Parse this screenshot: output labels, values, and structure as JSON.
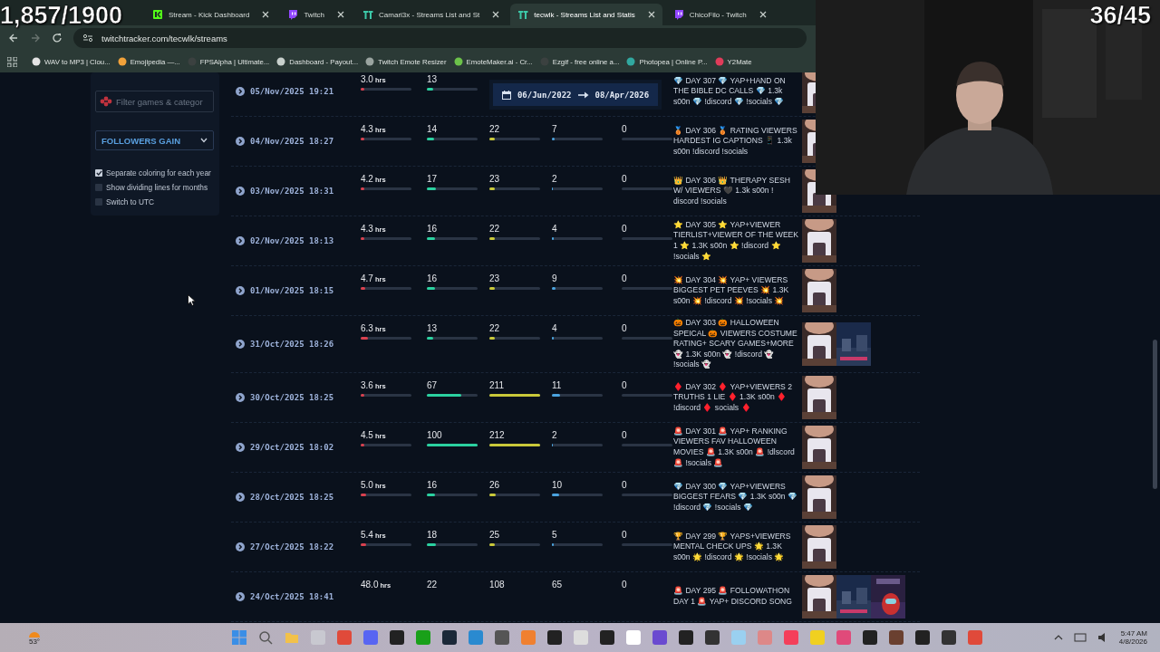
{
  "overlay": {
    "left_counter": "1,857/1900",
    "right_counter": "36/45"
  },
  "browser": {
    "tabs": [
      {
        "kind": "kick",
        "title": "Stream - Kick Dashboard",
        "selected": false
      },
      {
        "kind": "twitch",
        "title": "Twitch",
        "selected": false
      },
      {
        "kind": "tracker",
        "title": "Camari3x - Streams List and St",
        "selected": false
      },
      {
        "kind": "tracker",
        "title": "tecwlk - Streams List and Statis",
        "selected": true
      },
      {
        "kind": "twitch",
        "title": "ChicoFilo - Twitch",
        "selected": false
      }
    ],
    "address": "twitchtracker.com/tecwlk/streams",
    "bookmarks": [
      {
        "kind": "cloud",
        "title": "WAV to MP3 | Clou..."
      },
      {
        "kind": "emoji",
        "title": "Emojipedia —..."
      },
      {
        "kind": "dark",
        "title": "FPSAlpha | Ultimate..."
      },
      {
        "kind": "link",
        "title": "Dashboard - Payout..."
      },
      {
        "kind": "globe",
        "title": "Twitch Emote Resizer"
      },
      {
        "kind": "green",
        "title": "EmoteMaker.ai - Cr..."
      },
      {
        "kind": "dark",
        "title": "Ezgif - free online a..."
      },
      {
        "kind": "teal",
        "title": "Photopea | Online P..."
      },
      {
        "kind": "red",
        "title": "Y2Mate"
      }
    ]
  },
  "filters": {
    "search": {
      "placeholder": "Filter games & categor"
    },
    "metric": "FOLLOWERS GAIN",
    "options": [
      {
        "label": "Separate coloring for each year",
        "checked": true
      },
      {
        "label": "Show dividing lines for months",
        "checked": false
      },
      {
        "label": "Switch to UTC",
        "checked": false
      }
    ]
  },
  "date_range": {
    "from": "06/Jun/2022",
    "to": "08/Apr/2026"
  },
  "streams": [
    {
      "date": "05/Nov/2025 19:21",
      "hours": {
        "value": "3.0",
        "unit": "hrs",
        "level": 0.08
      },
      "metrics": [
        {
          "value": "13",
          "level": 0.13
        }
      ],
      "title": "💎 DAY 307 💎 YAP+HAND ON THE BIBLE DC CALLS 💎 1.3k s00n 💎 !discord 💎 !socials 💎",
      "thumbnails": [
        {
          "kind": "picture"
        }
      ]
    },
    {
      "date": "04/Nov/2025 18:27",
      "hours": {
        "value": "4.3",
        "unit": "hrs",
        "level": 0.08
      },
      "metrics": [
        {
          "value": "14",
          "level": 0.14
        },
        {
          "value": "22",
          "level": 0.1
        },
        {
          "value": "7",
          "level": 0.06
        },
        {
          "value": "0",
          "level": 0
        }
      ],
      "title": "🥉 DAY 306 🥉 RATING VIEWERS HARDEST IG CAPTIONS 📱 1.3k s00n !discord !socials",
      "thumbnails": [
        {
          "kind": "picture"
        }
      ]
    },
    {
      "date": "03/Nov/2025 18:31",
      "hours": {
        "value": "4.2",
        "unit": "hrs",
        "level": 0.08
      },
      "metrics": [
        {
          "value": "17",
          "level": 0.17
        },
        {
          "value": "23",
          "level": 0.1
        },
        {
          "value": "2",
          "level": 0.02
        },
        {
          "value": "0",
          "level": 0
        }
      ],
      "title": "👑 DAY 306 👑 THERAPY SESH W/ VIEWERS 🖤 1.3k s00n ! discord !socials",
      "thumbnails": [
        {
          "kind": "picture"
        }
      ]
    },
    {
      "date": "02/Nov/2025 18:13",
      "hours": {
        "value": "4.3",
        "unit": "hrs",
        "level": 0.08
      },
      "metrics": [
        {
          "value": "16",
          "level": 0.16
        },
        {
          "value": "22",
          "level": 0.1
        },
        {
          "value": "4",
          "level": 0.04
        },
        {
          "value": "0",
          "level": 0
        }
      ],
      "title": "⭐ DAY 305 ⭐ YAP+VIEWER TIERLIST+VIEWER OF THE WEEK 1 ⭐ 1.3K s00n ⭐ !discord ⭐ !socials ⭐",
      "thumbnails": [
        {
          "kind": "picture"
        }
      ]
    },
    {
      "date": "01/Nov/2025 18:15",
      "hours": {
        "value": "4.7",
        "unit": "hrs",
        "level": 0.09
      },
      "metrics": [
        {
          "value": "16",
          "level": 0.16
        },
        {
          "value": "23",
          "level": 0.1
        },
        {
          "value": "9",
          "level": 0.08
        },
        {
          "value": "0",
          "level": 0
        }
      ],
      "title": "💥 DAY 304 💥 YAP+ VIEWERS BIGGEST PET PEEVES 💥 1.3K s00n 💥 !discord 💥 !socials 💥",
      "thumbnails": [
        {
          "kind": "picture"
        }
      ]
    },
    {
      "date": "31/Oct/2025 18:26",
      "hours": {
        "value": "6.3",
        "unit": "hrs",
        "level": 0.14
      },
      "metrics": [
        {
          "value": "13",
          "level": 0.13
        },
        {
          "value": "22",
          "level": 0.1
        },
        {
          "value": "4",
          "level": 0.04
        },
        {
          "value": "0",
          "level": 0
        }
      ],
      "title": "🎃 DAY 303 🎃 HALLOWEEN SPEICAL 🎃 VIEWERS COSTUME RATING+ SCARY GAMES+MORE 👻 1.3K s00n 👻 !discord 👻 !socials 👻",
      "thumbnails": [
        {
          "kind": "picture"
        },
        {
          "kind": "picture"
        }
      ]
    },
    {
      "date": "30/Oct/2025 18:25",
      "hours": {
        "value": "3.6",
        "unit": "hrs",
        "level": 0.08
      },
      "metrics": [
        {
          "value": "67",
          "level": 0.68
        },
        {
          "value": "211",
          "level": 1
        },
        {
          "value": "11",
          "level": 0.16
        },
        {
          "value": "0",
          "level": 0
        }
      ],
      "title": "♦️ DAY 302 ♦️ YAP+VIEWERS 2 TRUTHS 1 LIE ♦️ 1.3K s00n ♦️ !discord ♦️ socials ♦️",
      "thumbnails": [
        {
          "kind": "picture"
        }
      ]
    },
    {
      "date": "29/Oct/2025 18:02",
      "hours": {
        "value": "4.5",
        "unit": "hrs",
        "level": 0.08
      },
      "metrics": [
        {
          "value": "100",
          "level": 1
        },
        {
          "value": "212",
          "level": 1
        },
        {
          "value": "2",
          "level": 0.02
        },
        {
          "value": "0",
          "level": 0
        }
      ],
      "title": "🚨 DAY 301 🚨 YAP+ RANKING VIEWERS FAV HALLOWEEN MOVIES 🚨 1.3K s00n 🚨 !dlscord 🚨 !socials 🚨",
      "thumbnails": [
        {
          "kind": "picture"
        }
      ]
    },
    {
      "date": "28/Oct/2025 18:25",
      "hours": {
        "value": "5.0",
        "unit": "hrs",
        "level": 0.1
      },
      "metrics": [
        {
          "value": "16",
          "level": 0.16
        },
        {
          "value": "26",
          "level": 0.12
        },
        {
          "value": "10",
          "level": 0.15
        },
        {
          "value": "0",
          "level": 0
        }
      ],
      "title": "💎 DAY 300 💎 YAP+VIEWERS BIGGEST FEARS 💎 1.3K s00n 💎 !discord 💎 !socials 💎",
      "thumbnails": [
        {
          "kind": "picture"
        }
      ]
    },
    {
      "date": "27/Oct/2025 18:22",
      "hours": {
        "value": "5.4",
        "unit": "hrs",
        "level": 0.1
      },
      "metrics": [
        {
          "value": "18",
          "level": 0.18
        },
        {
          "value": "25",
          "level": 0.1
        },
        {
          "value": "5",
          "level": 0.04
        },
        {
          "value": "0",
          "level": 0
        }
      ],
      "title": "🏆 DAY 299 🏆 YAPS+VIEWERS MENTAL CHECK UPS 🌟 1.3K s00n 🌟 !discord 🌟 !socials 🌟",
      "thumbnails": [
        {
          "kind": "picture"
        }
      ]
    },
    {
      "date": "24/Oct/2025 18:41",
      "hours": {
        "value": "48.0",
        "unit": "hrs"
      },
      "metrics": [
        {
          "value": "22"
        },
        {
          "value": "108"
        },
        {
          "value": "65"
        },
        {
          "value": "0"
        }
      ],
      "title": "🚨 DAY 295 🚨 FOLLOWATHON DAY 1 🚨 YAP+ DISCORD SONG",
      "thumbnails": [
        {
          "kind": "picture"
        },
        {
          "kind": "picture"
        },
        {
          "kind": "picture"
        }
      ]
    }
  ],
  "taskbar": {
    "weather": "53°",
    "time": "5:47 AM",
    "date": "4/8/2026"
  }
}
